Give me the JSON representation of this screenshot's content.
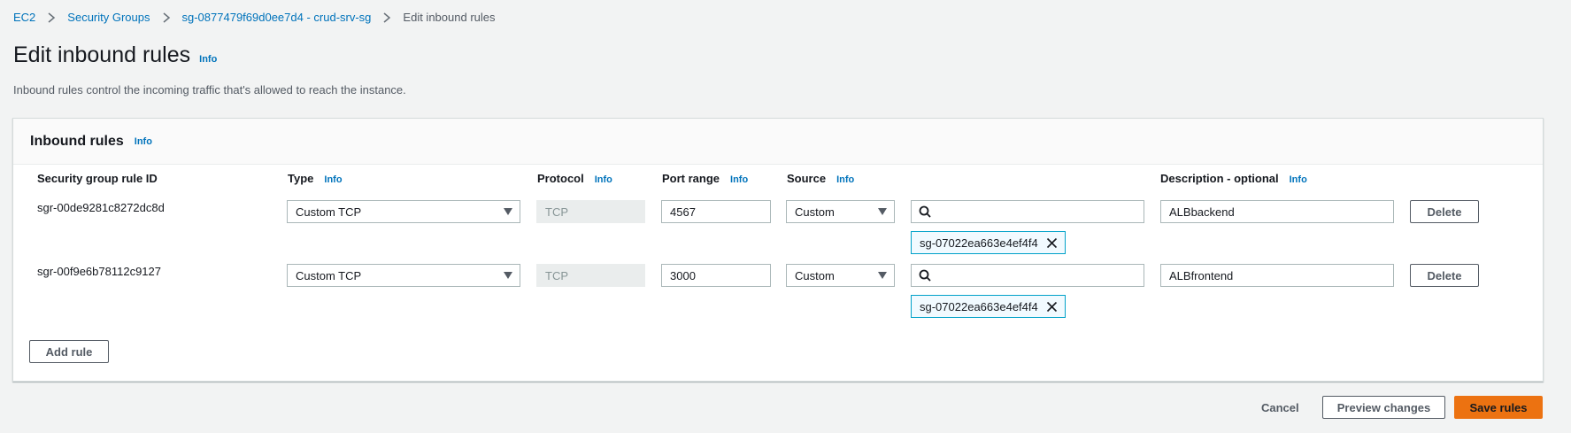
{
  "breadcrumb": {
    "items": [
      {
        "label": "EC2"
      },
      {
        "label": "Security Groups"
      },
      {
        "label": "sg-0877479f69d0ee7d4 - crud-srv-sg"
      },
      {
        "label": "Edit inbound rules"
      }
    ]
  },
  "page": {
    "title": "Edit inbound rules",
    "info": "Info",
    "description": "Inbound rules control the incoming traffic that's allowed to reach the instance."
  },
  "panel": {
    "title": "Inbound rules",
    "info": "Info",
    "columns": {
      "rule_id": "Security group rule ID",
      "type": "Type",
      "protocol": "Protocol",
      "port_range": "Port range",
      "source": "Source",
      "description": "Description - optional",
      "info": "Info"
    },
    "rules": [
      {
        "rule_id": "sgr-00de9281c8272dc8d",
        "type": "Custom TCP",
        "protocol": "TCP",
        "port_range": "4567",
        "source": "Custom",
        "source_search": "",
        "source_token": "sg-07022ea663e4ef4f4",
        "description": "ALBbackend",
        "delete_label": "Delete"
      },
      {
        "rule_id": "sgr-00f9e6b78112c9127",
        "type": "Custom TCP",
        "protocol": "TCP",
        "port_range": "3000",
        "source": "Custom",
        "source_search": "",
        "source_token": "sg-07022ea663e4ef4f4",
        "description": "ALBfrontend",
        "delete_label": "Delete"
      }
    ],
    "add_rule_label": "Add rule"
  },
  "footer": {
    "cancel_label": "Cancel",
    "preview_label": "Preview changes",
    "save_label": "Save rules"
  },
  "colors": {
    "accent": "#0073bb",
    "primary_button": "#ec7211",
    "token_border": "#00a1c9"
  }
}
